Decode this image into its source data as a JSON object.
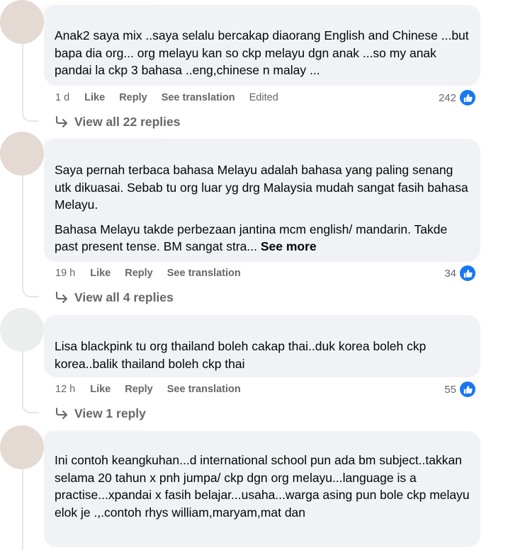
{
  "comments": [
    {
      "paragraphs": [
        "Anak2 saya mix ..saya selalu bercakap diaorang English and Chinese ...but bapa dia org... org melayu kan so ckp melayu dgn anak ...so my anak pandai la ckp 3 bahasa ..eng,chinese n malay ..."
      ],
      "time": "1 d",
      "like": "Like",
      "reply": "Reply",
      "translate": "See translation",
      "edited": "Edited",
      "reactions": "242",
      "view_replies": "View all 22 replies"
    },
    {
      "paragraphs": [
        "Saya pernah terbaca bahasa Melayu adalah bahasa yang paling senang utk dikuasai. Sebab tu org luar yg drg Malaysia mudah sangat fasih bahasa Melayu.",
        "Bahasa Melayu takde perbezaan jantina mcm english/ mandarin. Takde past present tense. BM sangat stra..."
      ],
      "see_more": "See more",
      "time": "19 h",
      "like": "Like",
      "reply": "Reply",
      "translate": "See translation",
      "reactions": "34",
      "view_replies": "View all 4 replies"
    },
    {
      "paragraphs": [
        "Lisa blackpink tu org thailand boleh cakap thai..duk korea boleh ckp korea..balik thailand boleh ckp thai"
      ],
      "time": "12 h",
      "like": "Like",
      "reply": "Reply",
      "translate": "See translation",
      "reactions": "55",
      "view_replies": "View 1 reply"
    },
    {
      "paragraphs": [
        "Ini contoh keangkuhan...d international school pun ada bm subject..takkan selama 20 tahun x pnh jumpa/ ckp dgn org melayu...language is a practise...xpandai x fasih belajar...usaha...warga asing pun bole ckp melayu elok je .,.contoh rhys william,maryam,mat dan"
      ]
    }
  ],
  "icons": {
    "like": "thumbs-up-icon",
    "reply_arrow": "reply-arrow-icon"
  },
  "colors": {
    "bubble": "#f0f2f5",
    "like_badge": "#1877f2",
    "meta": "#65676b",
    "text": "#050505"
  }
}
